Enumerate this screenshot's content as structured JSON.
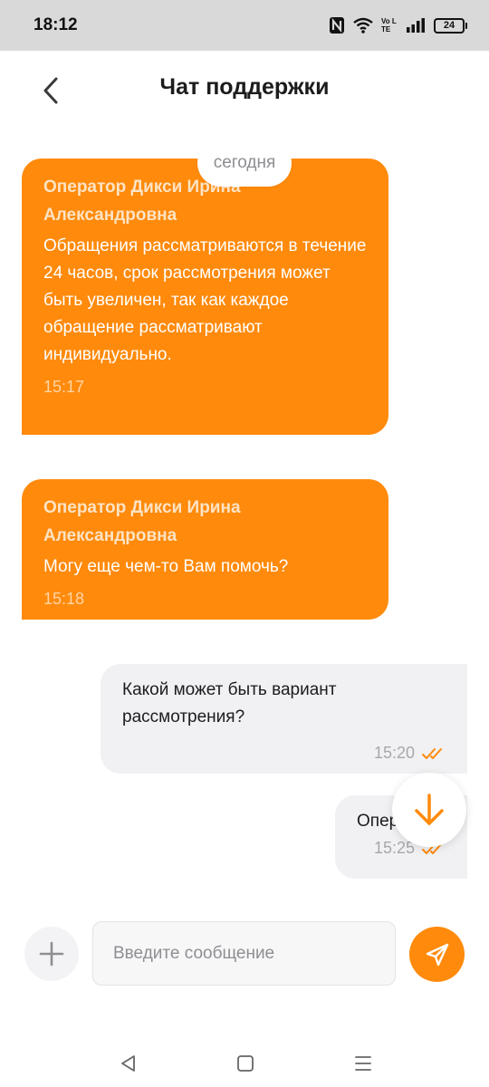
{
  "status_bar": {
    "time": "18:12",
    "network": "Vo LTE",
    "battery": "24"
  },
  "header": {
    "title": "Чат поддержки",
    "back_icon": "chevron-left-icon"
  },
  "date_separator": "сегодня",
  "messages": [
    {
      "from": "operator",
      "author": "Оператор Дикси Ирина Александровна",
      "text": "Обращения рассматриваются в течение 24 часов, срок рассмотрения может быть увеличен, так как каждое обращение рассматривают индивидуально.",
      "time": "15:17"
    },
    {
      "from": "operator",
      "author": "Оператор Дикси Ирина Александровна",
      "text": "Могу еще чем-то Вам помочь?",
      "time": "15:18"
    },
    {
      "from": "user",
      "text": "Какой может быть вариант\nрассмотрения?",
      "time": "15:20",
      "status_icon": "double-check-icon"
    },
    {
      "from": "user",
      "text": "Опер",
      "time": "15:25",
      "status_icon": "double-check-icon"
    }
  ],
  "composer": {
    "placeholder": "Введите сообщение",
    "value": ""
  },
  "colors": {
    "accent": "#ff8a0b",
    "user_bubble": "#f1f1f3",
    "status_bar": "#d9d9d9"
  }
}
